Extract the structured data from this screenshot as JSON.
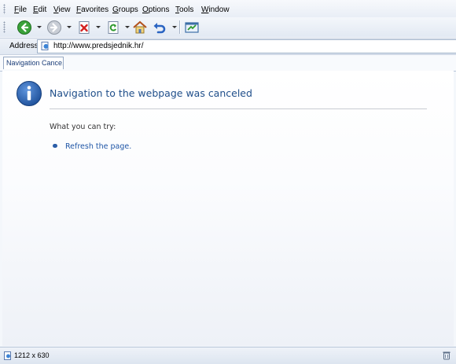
{
  "menu": [
    "File",
    "Edit",
    "View",
    "Favorites",
    "Groups",
    "Options",
    "Tools",
    "Window"
  ],
  "address": {
    "label": "Address",
    "url": "http://www.predsjednik.hr/"
  },
  "tab": {
    "title": "Navigation Cance..."
  },
  "page": {
    "title": "Navigation to the webpage was canceled",
    "try_label": "What you can try:",
    "refresh_link": "Refresh the page."
  },
  "status": {
    "size": "1212 x 630"
  },
  "colors": {
    "title_blue": "#1f4e8a",
    "link_blue": "#1f56a6",
    "info_icon_blue": "#2356a6"
  },
  "icons": [
    "back-icon",
    "forward-icon",
    "stop-icon",
    "refresh-icon",
    "home-icon",
    "undo-icon",
    "fullscreen-icon",
    "info-icon",
    "page-icon",
    "recycle-bin-icon"
  ]
}
